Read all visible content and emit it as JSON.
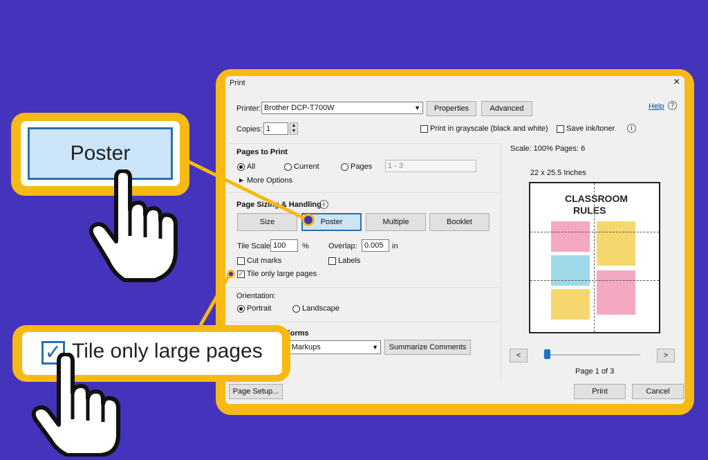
{
  "dialog": {
    "title": "Print",
    "close_glyph": "×",
    "printer_label": "Printer:",
    "printer_value": "Brother DCP-T700W",
    "properties_label": "Properties",
    "advanced_label": "Advanced",
    "help_label": "Help",
    "copies_label": "Copies:",
    "copies_value": "1",
    "grayscale_label": "Print in grayscale (black and white)",
    "save_ink_label": "Save ink/toner",
    "pages_to_print": {
      "heading": "Pages to Print",
      "all": "All",
      "current": "Current",
      "pages": "Pages",
      "pages_range": "1 - 3",
      "more_options": "More Options"
    },
    "sizing": {
      "heading": "Page Sizing & Handling",
      "size": "Size",
      "poster": "Poster",
      "multiple": "Multiple",
      "booklet": "Booklet",
      "tile_scale_label": "Tile Scale:",
      "tile_scale_value": "100",
      "percent": "%",
      "overlap_label": "Overlap:",
      "overlap_value": "0.005",
      "overlap_unit": "in",
      "cut_marks": "Cut marks",
      "labels": "Labels",
      "tile_only_large": "Tile only large pages"
    },
    "orientation": {
      "heading": "Orientation:",
      "portrait": "Portrait",
      "landscape": "Landscape"
    },
    "comments_forms": {
      "heading": "Comments & Forms",
      "value": "Document and Markups",
      "summarize": "Summarize Comments"
    },
    "preview": {
      "scale_text": "Scale: 100% Pages: 6",
      "dimensions": "22 x 25.5 Inches",
      "page_indicator": "Page 1 of 3",
      "prev": "<",
      "next": ">",
      "poster_title_1": "CLASSROOM",
      "poster_title_2": "RULES"
    },
    "page_setup": "Page Setup...",
    "print": "Print",
    "cancel": "Cancel"
  },
  "callouts": {
    "poster_zoom": "Poster",
    "tile_zoom": "Tile only large pages"
  },
  "colors": {
    "background": "#4433bb",
    "accent": "#f7b914",
    "highlight_button": "#cce4f7"
  }
}
